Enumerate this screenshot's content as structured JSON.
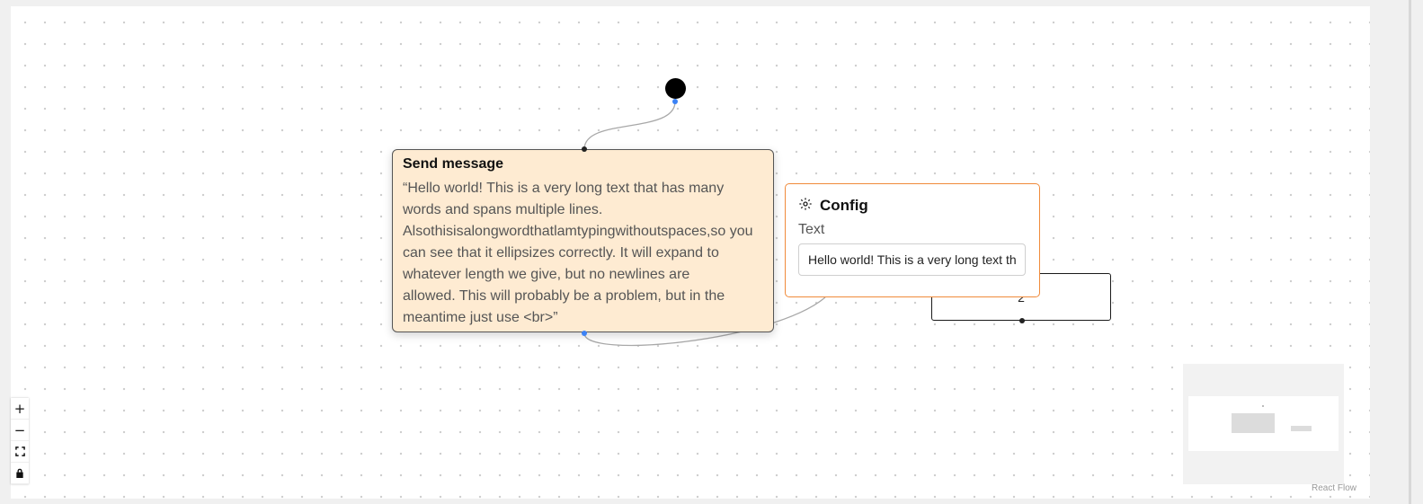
{
  "send_node": {
    "title": "Send message",
    "lines": [
      "“Hello world! This is a very long text that has many",
      "words and spans multiple lines.",
      "Alsothisisalongwordthatlamtypingwithoutspaces,so you",
      "can see that it ellipsizes correctly. It will expand to",
      "whatever length we give, but no newlines are",
      "allowed. This will probably be a problem, but in the",
      "meantime just use <br>”"
    ]
  },
  "node2": {
    "label": "2"
  },
  "config": {
    "icon": "gear-icon",
    "title": "Config",
    "field_label": "Text",
    "field_value": "Hello world! This is a very long text that has many words and spans multiple lines."
  },
  "controls": {
    "zoom_in": "+",
    "zoom_out": "−",
    "fit_view_icon": "fit-view-icon",
    "lock_icon": "lock-icon"
  },
  "attribution": "React Flow",
  "colors": {
    "node_bg": "#feebd2",
    "config_border": "#f08a3a",
    "handle_blue": "#3b82f6"
  }
}
